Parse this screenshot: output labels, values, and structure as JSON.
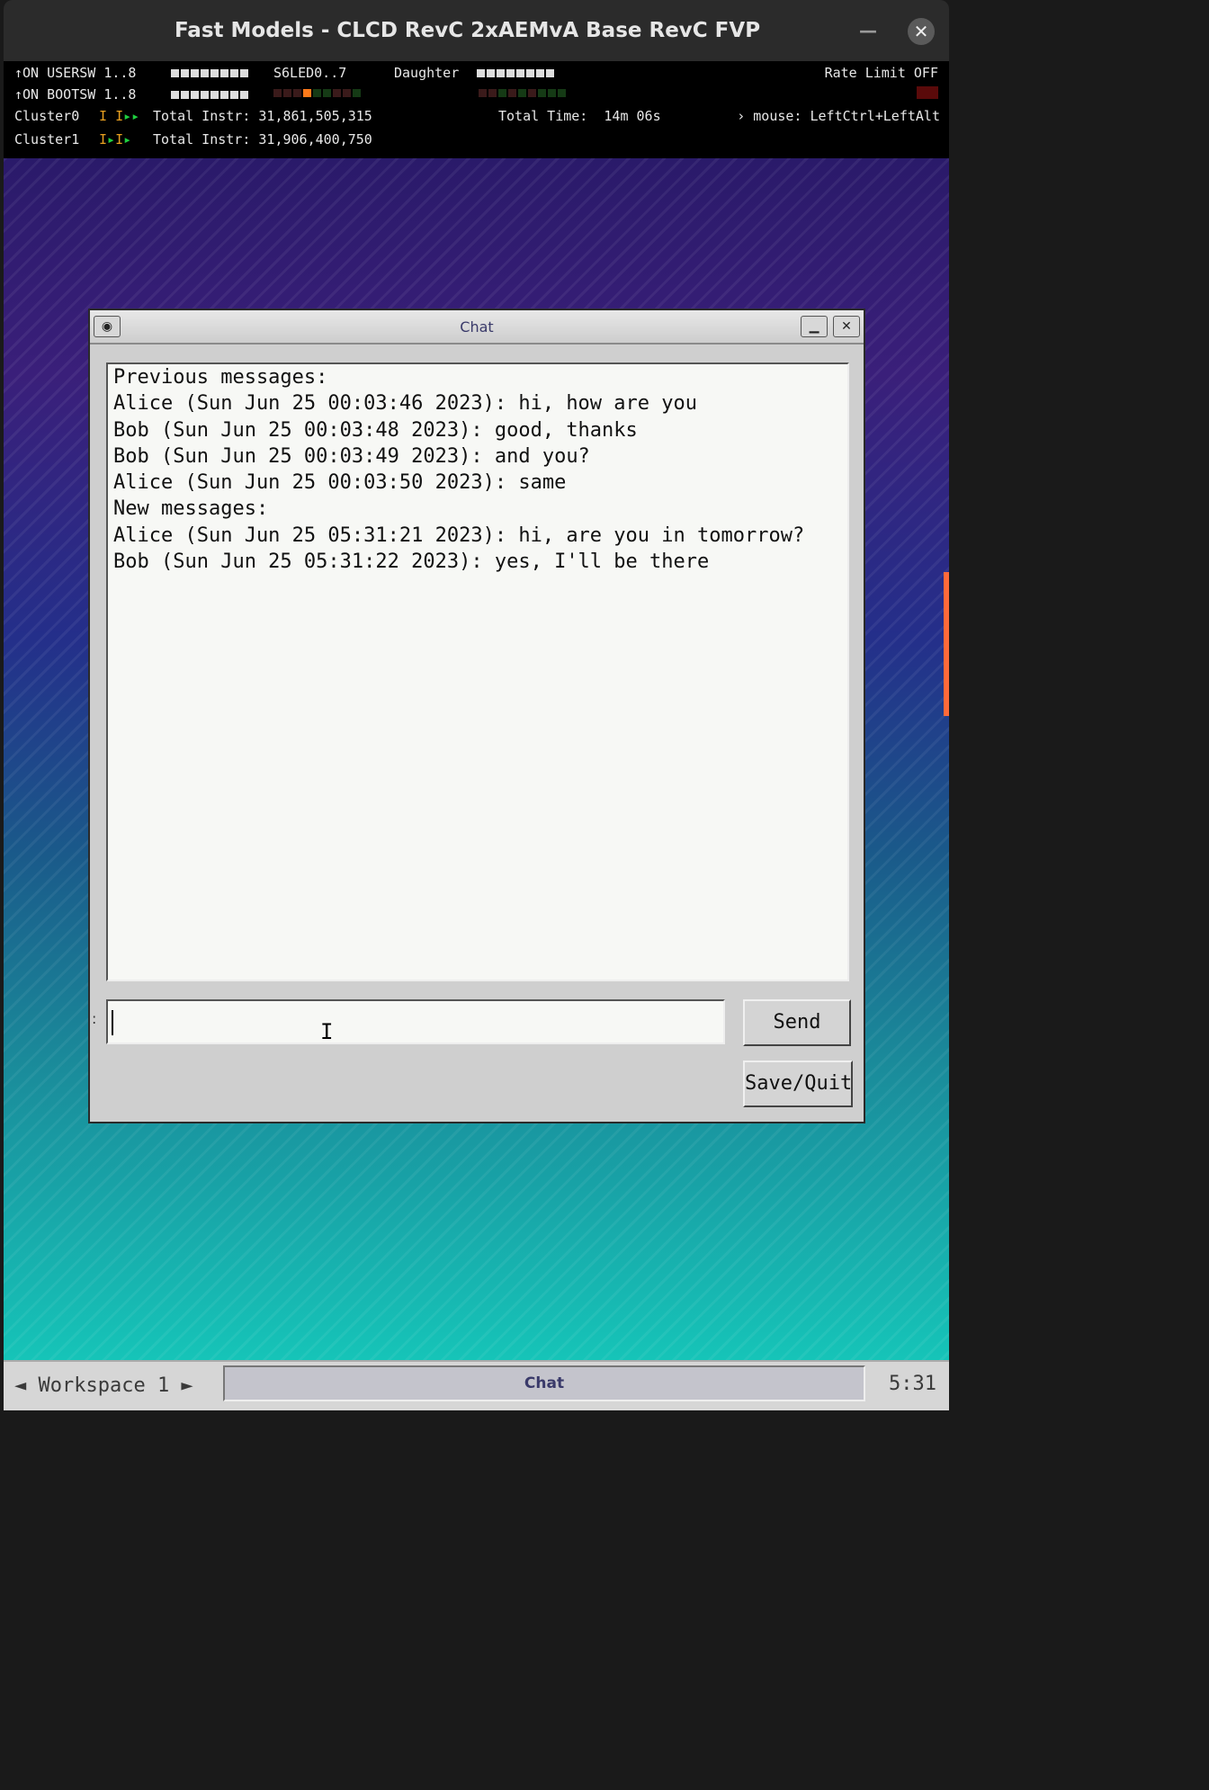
{
  "window": {
    "title": "Fast Models - CLCD RevC 2xAEMvA Base RevC FVP",
    "minimize_icon": "minimize-icon",
    "close_icon": "close-icon"
  },
  "status": {
    "usersw_label": "↑ON USERSW 1..8",
    "bootsw_label": "↑ON BOOTSW 1..8",
    "s6led_label": "S6LED0..7",
    "daughter_label": "Daughter",
    "rate_limit": "Rate Limit OFF",
    "cluster0_label": "Cluster0",
    "cluster0_instr": "Total Instr: 31,861,505,315",
    "cluster1_label": "Cluster1",
    "cluster1_instr": "Total Instr: 31,906,400,750",
    "total_time": "Total Time:  14m 06s",
    "mouse_hint": "› mouse: LeftCtrl+LeftAlt"
  },
  "chat": {
    "title": "Chat",
    "menu_icon": "window-menu-icon",
    "minimize_icon": "minimize-icon",
    "close_icon": "close-icon",
    "lines": [
      "Previous messages:",
      "Alice (Sun Jun 25 00:03:46 2023): hi, how are you",
      "Bob (Sun Jun 25 00:03:48 2023): good, thanks",
      "Bob (Sun Jun 25 00:03:49 2023): and you?",
      "Alice (Sun Jun 25 00:03:50 2023): same",
      "New messages:",
      "Alice (Sun Jun 25 05:31:21 2023): hi, are you in tomorrow?",
      "Bob (Sun Jun 25 05:31:22 2023): yes, I'll be there"
    ],
    "input_value": "",
    "send_label": "Send",
    "savequit_label": "Save/Quit"
  },
  "taskbar": {
    "workspace": "◄ Workspace 1 ►",
    "task": "Chat",
    "clock": "5:31"
  },
  "colors": {
    "status_bg": "#000000",
    "chat_title_text": "#3a3a6a",
    "led_orange": "#ff7a1a",
    "led_green": "#1fcf3f"
  }
}
